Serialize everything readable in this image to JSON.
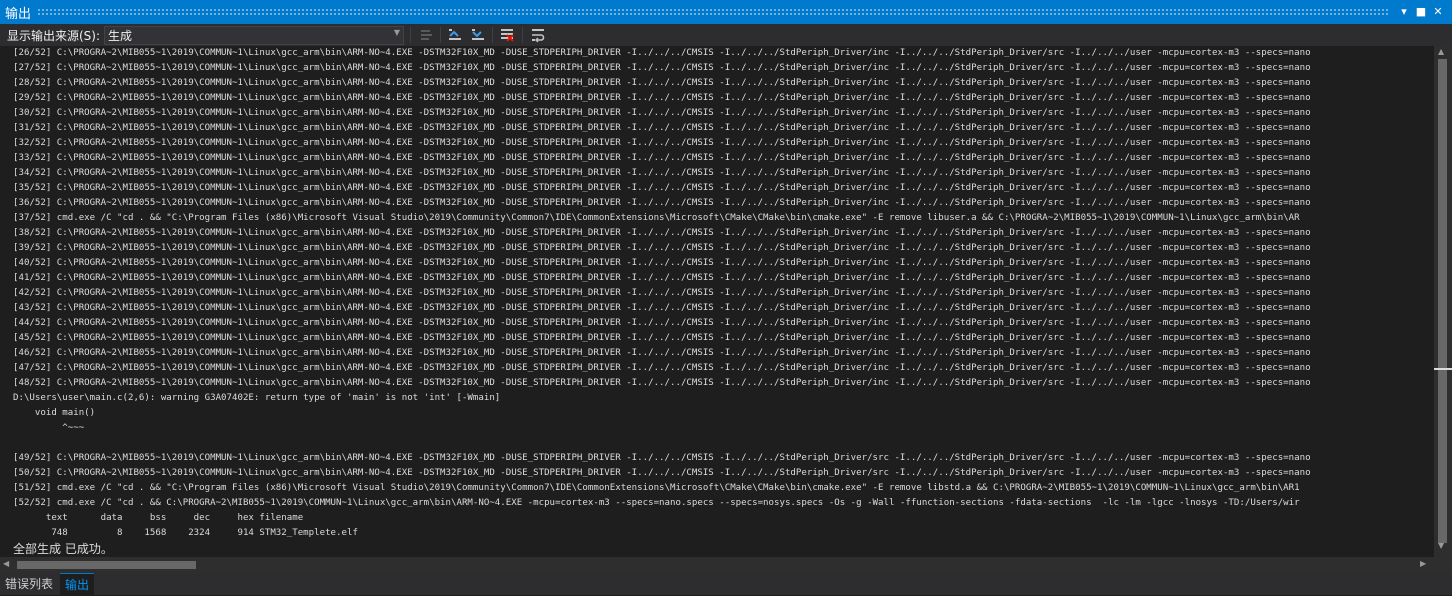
{
  "window": {
    "title": "输出",
    "controls": {
      "dropdown": "▾",
      "maximize": "■",
      "close": "✕"
    }
  },
  "toolbar": {
    "source_label": "显示输出来源(S):",
    "source_value": "生成",
    "icons": [
      "find-message-icon",
      "previous-message-icon",
      "next-message-icon",
      "clear-all-icon",
      "toggle-word-wrap-icon"
    ]
  },
  "output": {
    "lines": [
      "[26/52] C:\\PROGRA~2\\MIB055~1\\2019\\COMMUN~1\\Linux\\gcc_arm\\bin\\ARM-NO~4.EXE -DSTM32F10X_MD -DUSE_STDPERIPH_DRIVER -I../../../CMSIS -I../../../StdPeriph_Driver/inc -I../../../StdPeriph_Driver/src -I../../../user -mcpu=cortex-m3 --specs=nano",
      "[27/52] C:\\PROGRA~2\\MIB055~1\\2019\\COMMUN~1\\Linux\\gcc_arm\\bin\\ARM-NO~4.EXE -DSTM32F10X_MD -DUSE_STDPERIPH_DRIVER -I../../../CMSIS -I../../../StdPeriph_Driver/inc -I../../../StdPeriph_Driver/src -I../../../user -mcpu=cortex-m3 --specs=nano",
      "[28/52] C:\\PROGRA~2\\MIB055~1\\2019\\COMMUN~1\\Linux\\gcc_arm\\bin\\ARM-NO~4.EXE -DSTM32F10X_MD -DUSE_STDPERIPH_DRIVER -I../../../CMSIS -I../../../StdPeriph_Driver/inc -I../../../StdPeriph_Driver/src -I../../../user -mcpu=cortex-m3 --specs=nano",
      "[29/52] C:\\PROGRA~2\\MIB055~1\\2019\\COMMUN~1\\Linux\\gcc_arm\\bin\\ARM-NO~4.EXE -DSTM32F10X_MD -DUSE_STDPERIPH_DRIVER -I../../../CMSIS -I../../../StdPeriph_Driver/inc -I../../../StdPeriph_Driver/src -I../../../user -mcpu=cortex-m3 --specs=nano",
      "[30/52] C:\\PROGRA~2\\MIB055~1\\2019\\COMMUN~1\\Linux\\gcc_arm\\bin\\ARM-NO~4.EXE -DSTM32F10X_MD -DUSE_STDPERIPH_DRIVER -I../../../CMSIS -I../../../StdPeriph_Driver/inc -I../../../StdPeriph_Driver/src -I../../../user -mcpu=cortex-m3 --specs=nano",
      "[31/52] C:\\PROGRA~2\\MIB055~1\\2019\\COMMUN~1\\Linux\\gcc_arm\\bin\\ARM-NO~4.EXE -DSTM32F10X_MD -DUSE_STDPERIPH_DRIVER -I../../../CMSIS -I../../../StdPeriph_Driver/inc -I../../../StdPeriph_Driver/src -I../../../user -mcpu=cortex-m3 --specs=nano",
      "[32/52] C:\\PROGRA~2\\MIB055~1\\2019\\COMMUN~1\\Linux\\gcc_arm\\bin\\ARM-NO~4.EXE -DSTM32F10X_MD -DUSE_STDPERIPH_DRIVER -I../../../CMSIS -I../../../StdPeriph_Driver/inc -I../../../StdPeriph_Driver/src -I../../../user -mcpu=cortex-m3 --specs=nano",
      "[33/52] C:\\PROGRA~2\\MIB055~1\\2019\\COMMUN~1\\Linux\\gcc_arm\\bin\\ARM-NO~4.EXE -DSTM32F10X_MD -DUSE_STDPERIPH_DRIVER -I../../../CMSIS -I../../../StdPeriph_Driver/inc -I../../../StdPeriph_Driver/src -I../../../user -mcpu=cortex-m3 --specs=nano",
      "[34/52] C:\\PROGRA~2\\MIB055~1\\2019\\COMMUN~1\\Linux\\gcc_arm\\bin\\ARM-NO~4.EXE -DSTM32F10X_MD -DUSE_STDPERIPH_DRIVER -I../../../CMSIS -I../../../StdPeriph_Driver/inc -I../../../StdPeriph_Driver/src -I../../../user -mcpu=cortex-m3 --specs=nano",
      "[35/52] C:\\PROGRA~2\\MIB055~1\\2019\\COMMUN~1\\Linux\\gcc_arm\\bin\\ARM-NO~4.EXE -DSTM32F10X_MD -DUSE_STDPERIPH_DRIVER -I../../../CMSIS -I../../../StdPeriph_Driver/inc -I../../../StdPeriph_Driver/src -I../../../user -mcpu=cortex-m3 --specs=nano",
      "[36/52] C:\\PROGRA~2\\MIB055~1\\2019\\COMMUN~1\\Linux\\gcc_arm\\bin\\ARM-NO~4.EXE -DSTM32F10X_MD -DUSE_STDPERIPH_DRIVER -I../../../CMSIS -I../../../StdPeriph_Driver/inc -I../../../StdPeriph_Driver/src -I../../../user -mcpu=cortex-m3 --specs=nano",
      "[37/52] cmd.exe /C \"cd . && \"C:\\Program Files (x86)\\Microsoft Visual Studio\\2019\\Community\\Common7\\IDE\\CommonExtensions\\Microsoft\\CMake\\CMake\\bin\\cmake.exe\" -E remove libuser.a && C:\\PROGRA~2\\MIB055~1\\2019\\COMMUN~1\\Linux\\gcc_arm\\bin\\AR",
      "[38/52] C:\\PROGRA~2\\MIB055~1\\2019\\COMMUN~1\\Linux\\gcc_arm\\bin\\ARM-NO~4.EXE -DSTM32F10X_MD -DUSE_STDPERIPH_DRIVER -I../../../CMSIS -I../../../StdPeriph_Driver/inc -I../../../StdPeriph_Driver/src -I../../../user -mcpu=cortex-m3 --specs=nano",
      "[39/52] C:\\PROGRA~2\\MIB055~1\\2019\\COMMUN~1\\Linux\\gcc_arm\\bin\\ARM-NO~4.EXE -DSTM32F10X_MD -DUSE_STDPERIPH_DRIVER -I../../../CMSIS -I../../../StdPeriph_Driver/inc -I../../../StdPeriph_Driver/src -I../../../user -mcpu=cortex-m3 --specs=nano",
      "[40/52] C:\\PROGRA~2\\MIB055~1\\2019\\COMMUN~1\\Linux\\gcc_arm\\bin\\ARM-NO~4.EXE -DSTM32F10X_MD -DUSE_STDPERIPH_DRIVER -I../../../CMSIS -I../../../StdPeriph_Driver/inc -I../../../StdPeriph_Driver/src -I../../../user -mcpu=cortex-m3 --specs=nano",
      "[41/52] C:\\PROGRA~2\\MIB055~1\\2019\\COMMUN~1\\Linux\\gcc_arm\\bin\\ARM-NO~4.EXE -DSTM32F10X_MD -DUSE_STDPERIPH_DRIVER -I../../../CMSIS -I../../../StdPeriph_Driver/inc -I../../../StdPeriph_Driver/src -I../../../user -mcpu=cortex-m3 --specs=nano",
      "[42/52] C:\\PROGRA~2\\MIB055~1\\2019\\COMMUN~1\\Linux\\gcc_arm\\bin\\ARM-NO~4.EXE -DSTM32F10X_MD -DUSE_STDPERIPH_DRIVER -I../../../CMSIS -I../../../StdPeriph_Driver/inc -I../../../StdPeriph_Driver/src -I../../../user -mcpu=cortex-m3 --specs=nano",
      "[43/52] C:\\PROGRA~2\\MIB055~1\\2019\\COMMUN~1\\Linux\\gcc_arm\\bin\\ARM-NO~4.EXE -DSTM32F10X_MD -DUSE_STDPERIPH_DRIVER -I../../../CMSIS -I../../../StdPeriph_Driver/inc -I../../../StdPeriph_Driver/src -I../../../user -mcpu=cortex-m3 --specs=nano",
      "[44/52] C:\\PROGRA~2\\MIB055~1\\2019\\COMMUN~1\\Linux\\gcc_arm\\bin\\ARM-NO~4.EXE -DSTM32F10X_MD -DUSE_STDPERIPH_DRIVER -I../../../CMSIS -I../../../StdPeriph_Driver/inc -I../../../StdPeriph_Driver/src -I../../../user -mcpu=cortex-m3 --specs=nano",
      "[45/52] C:\\PROGRA~2\\MIB055~1\\2019\\COMMUN~1\\Linux\\gcc_arm\\bin\\ARM-NO~4.EXE -DSTM32F10X_MD -DUSE_STDPERIPH_DRIVER -I../../../CMSIS -I../../../StdPeriph_Driver/inc -I../../../StdPeriph_Driver/src -I../../../user -mcpu=cortex-m3 --specs=nano",
      "[46/52] C:\\PROGRA~2\\MIB055~1\\2019\\COMMUN~1\\Linux\\gcc_arm\\bin\\ARM-NO~4.EXE -DSTM32F10X_MD -DUSE_STDPERIPH_DRIVER -I../../../CMSIS -I../../../StdPeriph_Driver/inc -I../../../StdPeriph_Driver/src -I../../../user -mcpu=cortex-m3 --specs=nano",
      "[47/52] C:\\PROGRA~2\\MIB055~1\\2019\\COMMUN~1\\Linux\\gcc_arm\\bin\\ARM-NO~4.EXE -DSTM32F10X_MD -DUSE_STDPERIPH_DRIVER -I../../../CMSIS -I../../../StdPeriph_Driver/inc -I../../../StdPeriph_Driver/src -I../../../user -mcpu=cortex-m3 --specs=nano",
      "[48/52] C:\\PROGRA~2\\MIB055~1\\2019\\COMMUN~1\\Linux\\gcc_arm\\bin\\ARM-NO~4.EXE -DSTM32F10X_MD -DUSE_STDPERIPH_DRIVER -I../../../CMSIS -I../../../StdPeriph_Driver/inc -I../../../StdPeriph_Driver/src -I../../../user -mcpu=cortex-m3 --specs=nano",
      "D:\\Users\\user\\main.c(2,6): warning G3A07402E: return type of 'main' is not 'int' [-Wmain]",
      "    void main()",
      "         ^~~~",
      "",
      "[49/52] C:\\PROGRA~2\\MIB055~1\\2019\\COMMUN~1\\Linux\\gcc_arm\\bin\\ARM-NO~4.EXE -DSTM32F10X_MD -DUSE_STDPERIPH_DRIVER -I../../../CMSIS -I../../../StdPeriph_Driver/src -I../../../StdPeriph_Driver/src -I../../../user -mcpu=cortex-m3 --specs=nano",
      "[50/52] C:\\PROGRA~2\\MIB055~1\\2019\\COMMUN~1\\Linux\\gcc_arm\\bin\\ARM-NO~4.EXE -DSTM32F10X_MD -DUSE_STDPERIPH_DRIVER -I../../../CMSIS -I../../../StdPeriph_Driver/src -I../../../StdPeriph_Driver/src -I../../../user -mcpu=cortex-m3 --specs=nano",
      "[51/52] cmd.exe /C \"cd . && \"C:\\Program Files (x86)\\Microsoft Visual Studio\\2019\\Community\\Common7\\IDE\\CommonExtensions\\Microsoft\\CMake\\CMake\\bin\\cmake.exe\" -E remove libstd.a && C:\\PROGRA~2\\MIB055~1\\2019\\COMMUN~1\\Linux\\gcc_arm\\bin\\AR1",
      "[52/52] cmd.exe /C \"cd . && C:\\PROGRA~2\\MIB055~1\\2019\\COMMUN~1\\Linux\\gcc_arm\\bin\\ARM-NO~4.EXE -mcpu=cortex-m3 --specs=nano.specs --specs=nosys.specs -Os -g -Wall -ffunction-sections -fdata-sections  -lc -lm -lgcc -lnosys -TD:/Users/wir",
      "      text      data     bss     dec     hex filename",
      "       748         8    1568    2324     914 STM32_Templete.elf",
      ""
    ],
    "done_message": "全部生成 已成功。"
  },
  "tabs": [
    {
      "label": "错误列表",
      "active": false
    },
    {
      "label": "输出",
      "active": true
    }
  ],
  "colors": {
    "title_bar": "#007acc",
    "toolbar": "#2d2d30",
    "editor_bg": "#1e1e1e",
    "text": "#dcdcdc",
    "active_tab_text": "#0097fb"
  }
}
